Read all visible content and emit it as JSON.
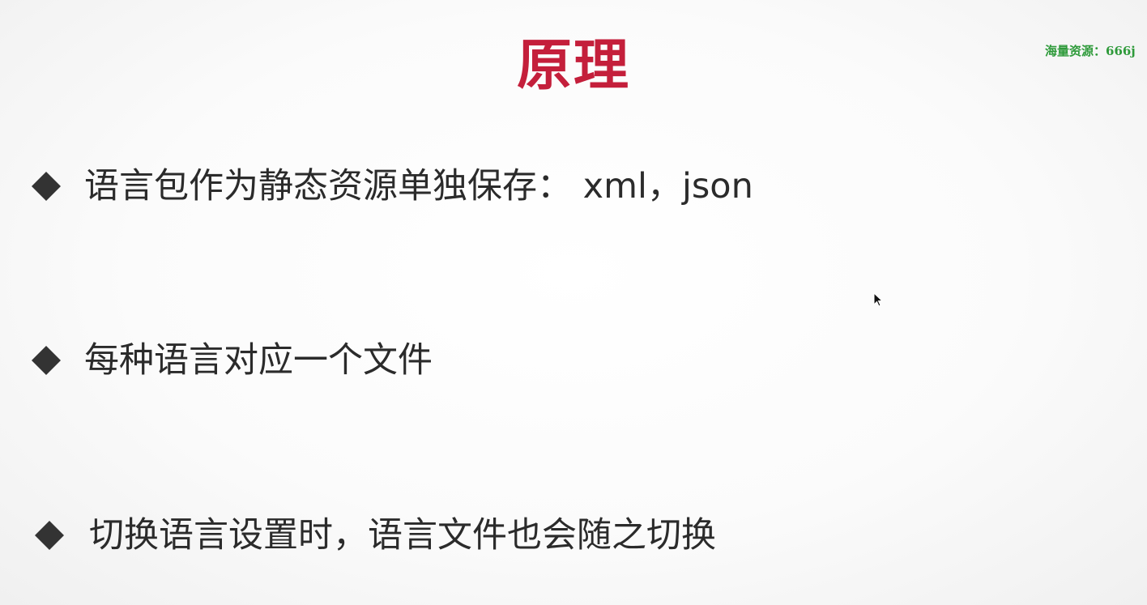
{
  "slide": {
    "title": "原理",
    "watermark": "海量资源：666j",
    "bullets": [
      {
        "text": "语言包作为静态资源单独保存： xml，json"
      },
      {
        "text": "每种语言对应一个文件"
      },
      {
        "text": "切换语言设置时，语言文件也会随之切换"
      }
    ]
  },
  "colors": {
    "title": "#c41f3b",
    "bullet_text": "#2b2b2b",
    "bullet_marker": "#333333",
    "watermark": "#2e9a3a",
    "background": "#fbfbfb"
  },
  "icons": {
    "bullet_marker": "diamond-icon",
    "pointer": "mouse-cursor-icon"
  }
}
